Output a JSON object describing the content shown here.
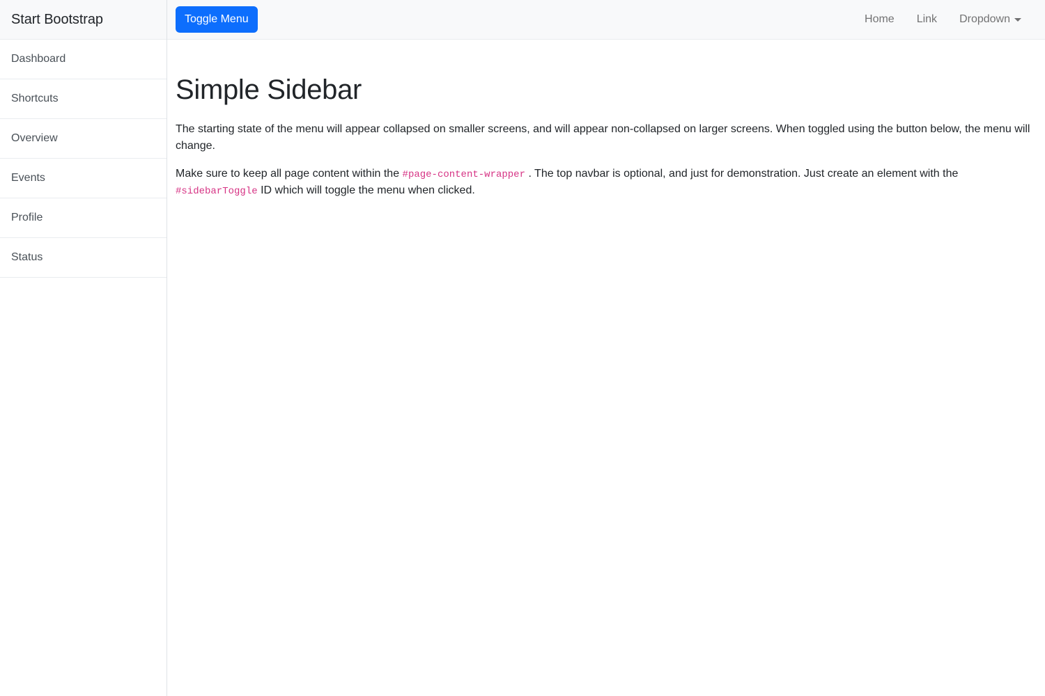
{
  "sidebar": {
    "heading": "Start Bootstrap",
    "items": [
      {
        "label": "Dashboard"
      },
      {
        "label": "Shortcuts"
      },
      {
        "label": "Overview"
      },
      {
        "label": "Events"
      },
      {
        "label": "Profile"
      },
      {
        "label": "Status"
      }
    ]
  },
  "navbar": {
    "toggle_label": "Toggle Menu",
    "links": [
      {
        "label": "Home"
      },
      {
        "label": "Link"
      },
      {
        "label": "Dropdown"
      }
    ],
    "dropdown_icon": "chevron-down-icon"
  },
  "main": {
    "title": "Simple Sidebar",
    "paragraph1": "The starting state of the menu will appear collapsed on smaller screens, and will appear non-collapsed on larger screens. When toggled using the button below, the menu will change.",
    "paragraph2": {
      "part1": "Make sure to keep all page content within the",
      "code1": "#page-content-wrapper",
      "part2": ". The top navbar is optional, and just for demonstration. Just create an element with the",
      "code2": "#sidebarToggle",
      "part3": "ID which will toggle the menu when clicked."
    }
  },
  "colors": {
    "primary": "#0d6efd",
    "code": "#d63384",
    "light": "#f8f9fa",
    "border": "#e9ecef",
    "muted": "#6c757d"
  }
}
